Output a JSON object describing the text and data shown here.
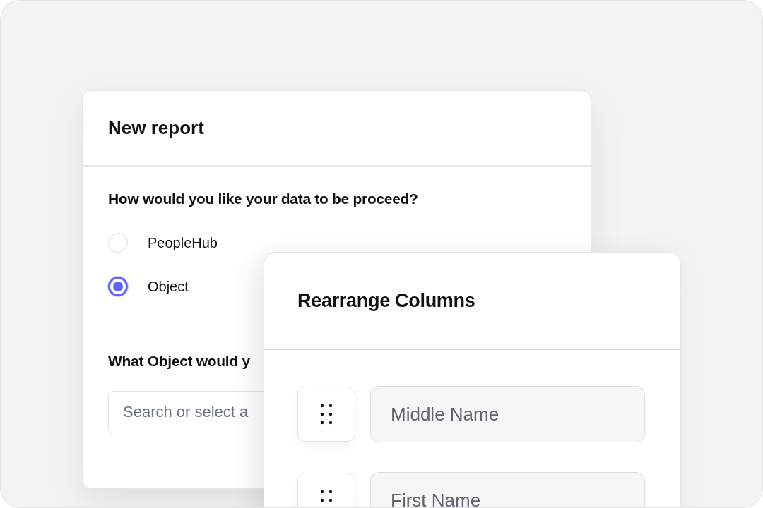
{
  "report_dialog": {
    "title": "New report",
    "question": "How would you like your data to be proceed?",
    "options": [
      {
        "label": "PeopleHub",
        "selected": false
      },
      {
        "label": "Object",
        "selected": true
      }
    ],
    "object_question": "What Object would y",
    "search": {
      "placeholder": "Search or select a"
    }
  },
  "rearrange_dialog": {
    "title": "Rearrange Columns",
    "columns": [
      {
        "name": "Middle Name"
      },
      {
        "name": "First Name"
      }
    ]
  }
}
